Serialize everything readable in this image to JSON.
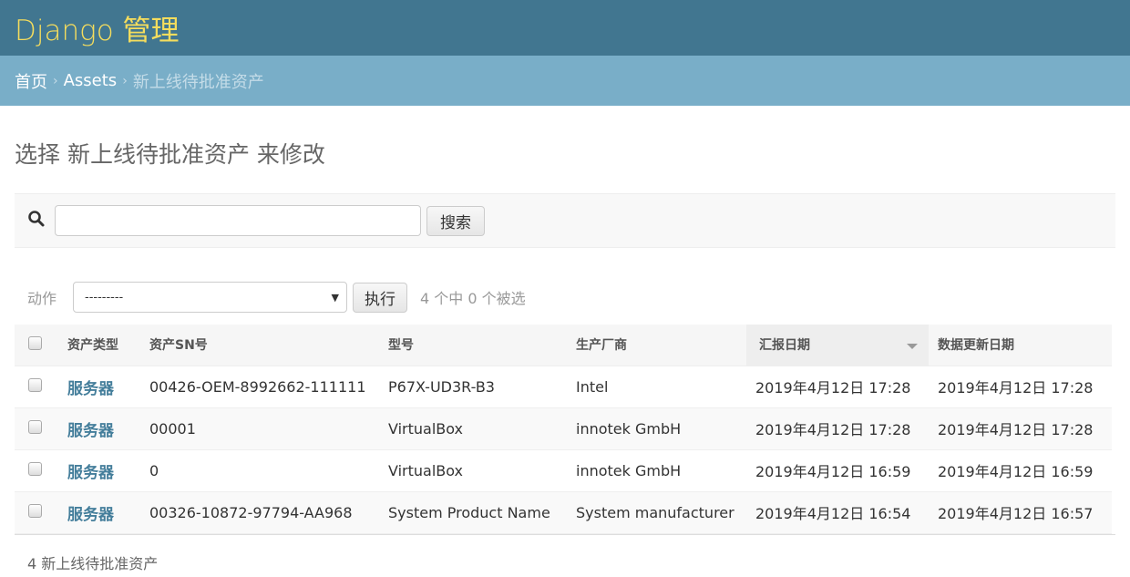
{
  "header": {
    "brand": "Django 管理"
  },
  "breadcrumb": {
    "home": "首页",
    "app": "Assets",
    "current": "新上线待批准资产",
    "sep": "›"
  },
  "page_title": "选择 新上线待批准资产 来修改",
  "search": {
    "value": "",
    "placeholder": "",
    "button": "搜索"
  },
  "actions": {
    "label": "动作",
    "selected": "---------",
    "run": "执行",
    "counter": "4 个中 0 个被选"
  },
  "table": {
    "headers": [
      "资产类型",
      "资产SN号",
      "型号",
      "生产厂商",
      "汇报日期",
      "数据更新日期"
    ],
    "rows": [
      [
        "服务器",
        "00426-OEM-8992662-111111",
        "P67X-UD3R-B3",
        "Intel",
        "2019年4月12日 17:28",
        "2019年4月12日 17:28"
      ],
      [
        "服务器",
        "00001",
        "VirtualBox",
        "innotek GmbH",
        "2019年4月12日 17:28",
        "2019年4月12日 17:28"
      ],
      [
        "服务器",
        "0",
        "VirtualBox",
        "innotek GmbH",
        "2019年4月12日 16:59",
        "2019年4月12日 16:59"
      ],
      [
        "服务器",
        "00326-10872-97794-AA968",
        "System Product Name",
        "System manufacturer",
        "2019年4月12日 16:54",
        "2019年4月12日 16:57"
      ]
    ]
  },
  "footer": "4 新上线待批准资产"
}
